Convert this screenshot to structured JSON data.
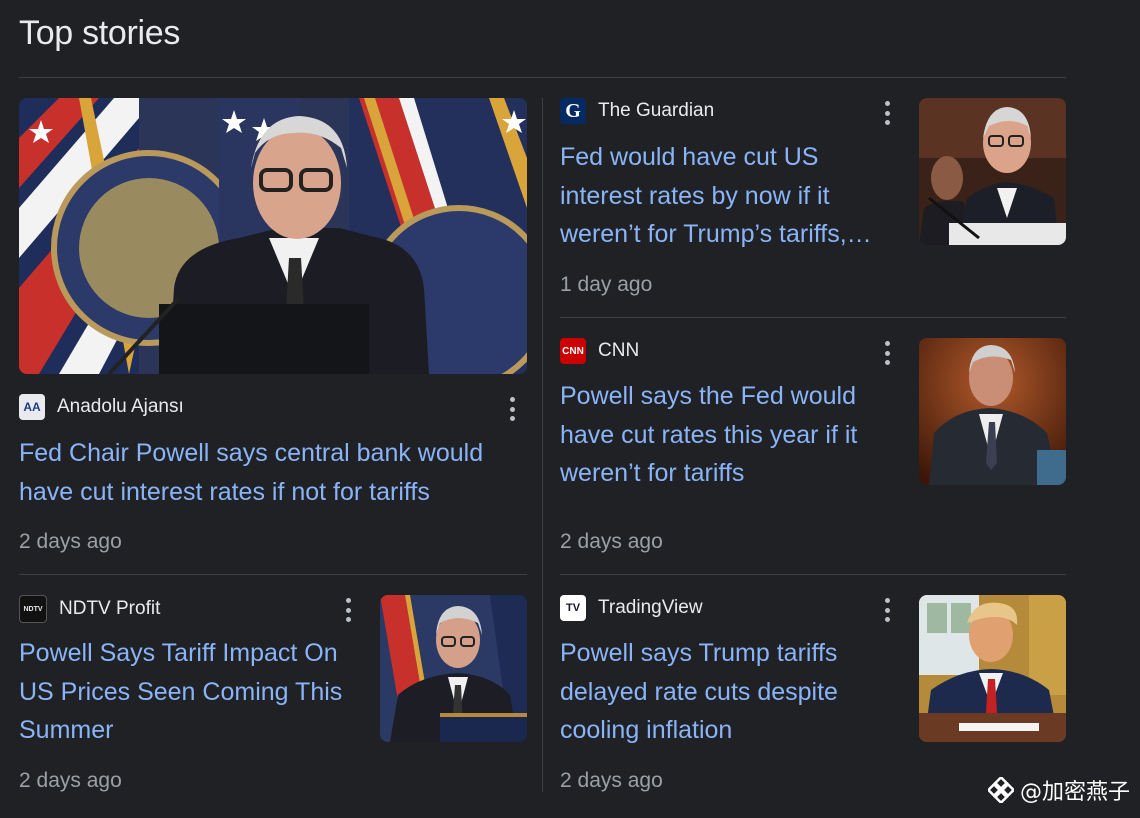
{
  "section_title": "Top stories",
  "stories": [
    {
      "source": "Anadolu Ajansı",
      "headline": "Fed Chair Powell says central bank would have cut interest rates if not for tariffs",
      "time": "2 days ago",
      "image": "powell-podium-flags-photo"
    },
    {
      "source": "The Guardian",
      "headline": "Fed would have cut US interest rates by now if it weren’t for Trump’s tariffs,…",
      "time": "1 day ago",
      "image": "powell-hearing-photo"
    },
    {
      "source": "CNN",
      "headline": "Powell says the Fed would have cut rates this year if it weren’t for tariffs",
      "time": "2 days ago",
      "image": "powell-portrait-photo"
    },
    {
      "source": "NDTV Profit",
      "headline": "Powell Says Tariff Impact On US Prices Seen Coming This Summer",
      "time": "2 days ago",
      "image": "powell-press-photo"
    },
    {
      "source": "TradingView",
      "headline": "Powell says Trump tariffs delayed rate cuts despite cooling inflation",
      "time": "2 days ago",
      "image": "trump-desk-photo"
    }
  ],
  "favicons": {
    "anadolu": "AA",
    "guardian": "G",
    "cnn": "CNN",
    "ndtv": "NDTV",
    "tradingview": "TV"
  },
  "watermark": "@加密燕子",
  "colors": {
    "background": "#202124",
    "link": "#8ab4f8",
    "muted": "#9aa0a6",
    "divider": "#3c4043"
  }
}
